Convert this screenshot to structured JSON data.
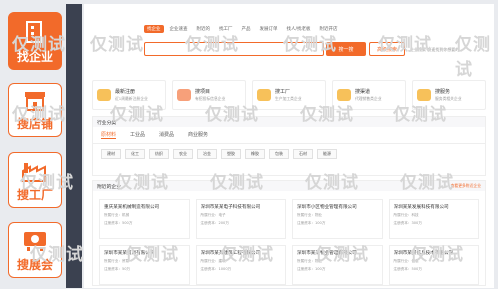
{
  "sidebar": [
    {
      "label": "找企业",
      "icon": "building-icon"
    },
    {
      "label": "搜店铺",
      "icon": "storefront-icon"
    },
    {
      "label": "搜工厂",
      "icon": "factory-icon"
    },
    {
      "label": "搜展会",
      "icon": "exhibition-icon"
    }
  ],
  "watermark": "仅测试",
  "colors": {
    "accent": "#f26a2a",
    "dark_strip": "#3b4150"
  },
  "header": {
    "tabs": [
      "找企业",
      "企业速查",
      "附近的",
      "找工厂",
      "产品",
      "发展订单",
      "找人/找老板",
      "附近开店"
    ],
    "search_button": "搜一搜",
    "pro_button": "高级搜索",
    "tip": "企业搜索·快速找到你想要的"
  },
  "categories": [
    {
      "title": "最新注册",
      "sub": "近1周最新注册企业",
      "color": "#f7c15a"
    },
    {
      "title": "搜项目",
      "sub": "有招投标信息企业",
      "color": "#f7a07a"
    },
    {
      "title": "搜工厂",
      "sub": "生产加工类企业",
      "color": "#f7c15a"
    },
    {
      "title": "搜渠道",
      "sub": "代理销售类企业",
      "color": "#f7c15a"
    },
    {
      "title": "搜服务",
      "sub": "服务类相关企业",
      "color": "#f7c15a"
    }
  ],
  "industry": {
    "title": "行业分类",
    "tabs": [
      "原材料",
      "工业品",
      "消费品",
      "商业服务"
    ],
    "keywords": [
      "建材",
      "化工",
      "纺织",
      "农业",
      "冶金",
      "塑胶",
      "橡胶",
      "包装",
      "石材",
      "能源"
    ]
  },
  "nearby": {
    "title": "附近的企业",
    "more": "查看更多附近企业",
    "cards": [
      {
        "name": "重庆某某机械制造有限公司",
        "l1": "所属行业：机械",
        "l2": "注册资本：500万"
      },
      {
        "name": "深圳市某某电子科技有限公司",
        "l1": "所属行业：电子",
        "l2": "注册资本：200万"
      },
      {
        "name": "深圳市小区物业管理有限公司",
        "l1": "所属行业：物业",
        "l2": "注册资本：100万"
      },
      {
        "name": "深圳某某发展科技有限公司",
        "l1": "所属行业：科技",
        "l2": "注册资本：300万"
      },
      {
        "name": "深圳市某某贸易有限公司",
        "l1": "所属行业：贸易",
        "l2": "注册资本：50万"
      },
      {
        "name": "深圳市某某建筑工程有限公司",
        "l1": "所属行业：建筑",
        "l2": "注册资本：1000万"
      },
      {
        "name": "深圳市某某物业管理有限公司",
        "l1": "所属行业：物业",
        "l2": "注册资本：100万"
      },
      {
        "name": "深圳市某某信息技术有限公司",
        "l1": "所属行业：信息",
        "l2": "注册资本：500万"
      }
    ]
  }
}
